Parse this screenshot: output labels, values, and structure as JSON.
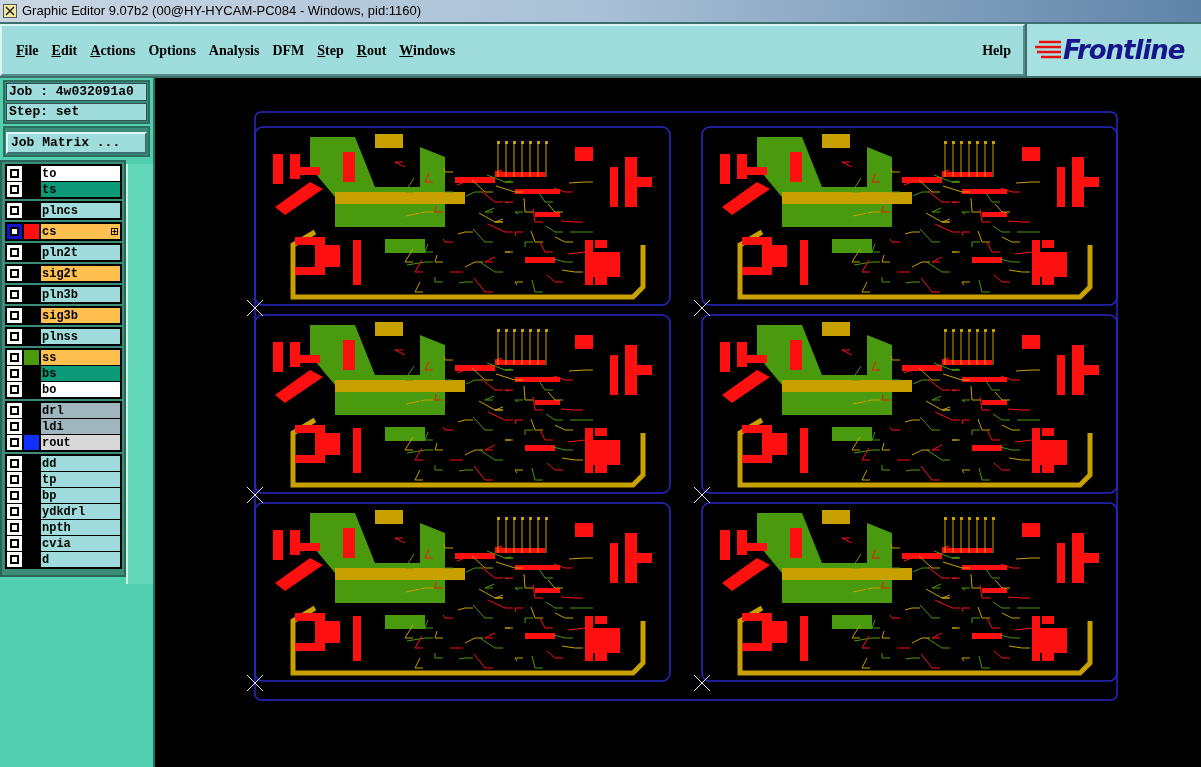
{
  "window": {
    "title": "Graphic Editor 9.07b2 (00@HY-HYCAM-PC084 - Windows, pid:1160)"
  },
  "menu": [
    {
      "label": "File",
      "mnemonic": true
    },
    {
      "label": "Edit",
      "mnemonic": true
    },
    {
      "label": "Actions",
      "mnemonic": true
    },
    {
      "label": "Options",
      "mnemonic": false
    },
    {
      "label": "Analysis",
      "mnemonic": false
    },
    {
      "label": "DFM",
      "mnemonic": false
    },
    {
      "label": "Step",
      "mnemonic": true
    },
    {
      "label": "Rout",
      "mnemonic": true
    },
    {
      "label": "Windows",
      "mnemonic": true
    }
  ],
  "help_menu": "Help",
  "logo": "Frontline",
  "job": "Job : 4w032091a0",
  "step": "Step: set",
  "job_matrix_button": "Job Matrix ...",
  "layer_groups": [
    {
      "layers": [
        {
          "name": "to",
          "color": "#ffffff",
          "selected": false
        },
        {
          "name": "ts",
          "color": "#0c9a78",
          "selected": false
        }
      ]
    },
    {
      "layers": [
        {
          "name": "plncs",
          "color": "#a0dcdc",
          "selected": false
        }
      ]
    },
    {
      "layers": [
        {
          "name": "cs",
          "color": "#ffc050",
          "selected": true,
          "swatch": {
            "color": "#ff1010"
          }
        }
      ]
    },
    {
      "layers": [
        {
          "name": "pln2t",
          "color": "#a0dcdc",
          "selected": false
        }
      ]
    },
    {
      "layers": [
        {
          "name": "sig2t",
          "color": "#ffc050",
          "selected": false
        }
      ]
    },
    {
      "layers": [
        {
          "name": "pln3b",
          "color": "#a0dcdc",
          "selected": false
        }
      ]
    },
    {
      "layers": [
        {
          "name": "sig3b",
          "color": "#ffc050",
          "selected": false
        }
      ]
    },
    {
      "layers": [
        {
          "name": "plnss",
          "color": "#a0dcdc",
          "selected": false
        }
      ]
    },
    {
      "layers": [
        {
          "name": "ss",
          "color": "#ffc050",
          "selected": false,
          "swatch": {
            "color": "#4a9a10"
          }
        },
        {
          "name": "bs",
          "color": "#0c9a78",
          "selected": false
        },
        {
          "name": "bo",
          "color": "#ffffff",
          "selected": false
        }
      ]
    },
    {
      "layers": [
        {
          "name": "drl",
          "color": "#9fb6bf",
          "selected": false
        },
        {
          "name": "ldi",
          "color": "#9fb6bf",
          "selected": false
        },
        {
          "name": "rout",
          "color": "#d8d8d8",
          "selected": false,
          "swatch": {
            "color": "#1030ff"
          }
        }
      ]
    },
    {
      "layers": [
        {
          "name": "dd",
          "color": "#a0dcdc",
          "selected": false
        },
        {
          "name": "tp",
          "color": "#a0dcdc",
          "selected": false
        },
        {
          "name": "bp",
          "color": "#a0dcdc",
          "selected": false
        },
        {
          "name": "ydkdrl",
          "color": "#a0dcdc",
          "selected": false
        },
        {
          "name": "npth",
          "color": "#a0dcdc",
          "selected": false
        },
        {
          "name": "cvia",
          "color": "#a0dcdc",
          "selected": false
        },
        {
          "name": "d",
          "color": "#a0dcdc",
          "selected": false
        }
      ]
    }
  ]
}
